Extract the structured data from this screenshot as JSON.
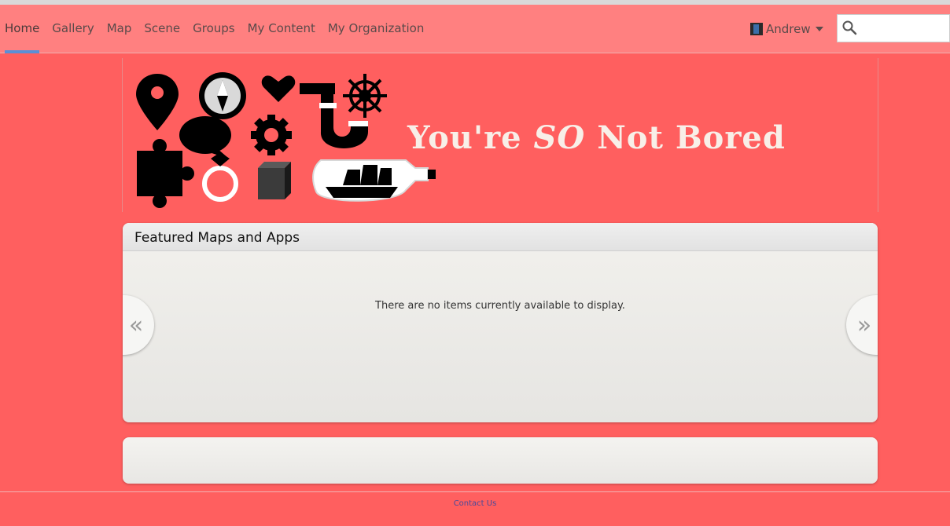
{
  "nav": {
    "items": [
      {
        "label": "Home",
        "active": true
      },
      {
        "label": "Gallery"
      },
      {
        "label": "Map"
      },
      {
        "label": "Scene"
      },
      {
        "label": "Groups"
      },
      {
        "label": "My Content"
      },
      {
        "label": "My Organization"
      }
    ],
    "user": {
      "name": "Andrew",
      "icon": "user-avatar"
    },
    "search": {
      "placeholder": "",
      "value": "",
      "icon": "search-icon"
    }
  },
  "banner": {
    "text_part1": "You're",
    "text_part2": "SO",
    "text_part3": "Not Bored",
    "icons": [
      "location-pin-icon",
      "compass-icon",
      "heart-icon",
      "pipe-icon",
      "ship-wheel-icon",
      "speech-bubble-icon",
      "gear-icon",
      "puzzle-piece-icon",
      "ring-icon",
      "cube-icon",
      "ship-in-bottle-icon"
    ]
  },
  "featured": {
    "title": "Featured Maps and Apps",
    "empty_message": "There are no items currently available to display.",
    "prev_label": "«",
    "next_label": "»"
  },
  "footer": {
    "contact_label": "Contact Us"
  },
  "colors": {
    "background": "#ff5f5f",
    "navbar": "#ff8080",
    "active_underline": "#5b8fd6",
    "banner_text": "#f8efe8"
  }
}
